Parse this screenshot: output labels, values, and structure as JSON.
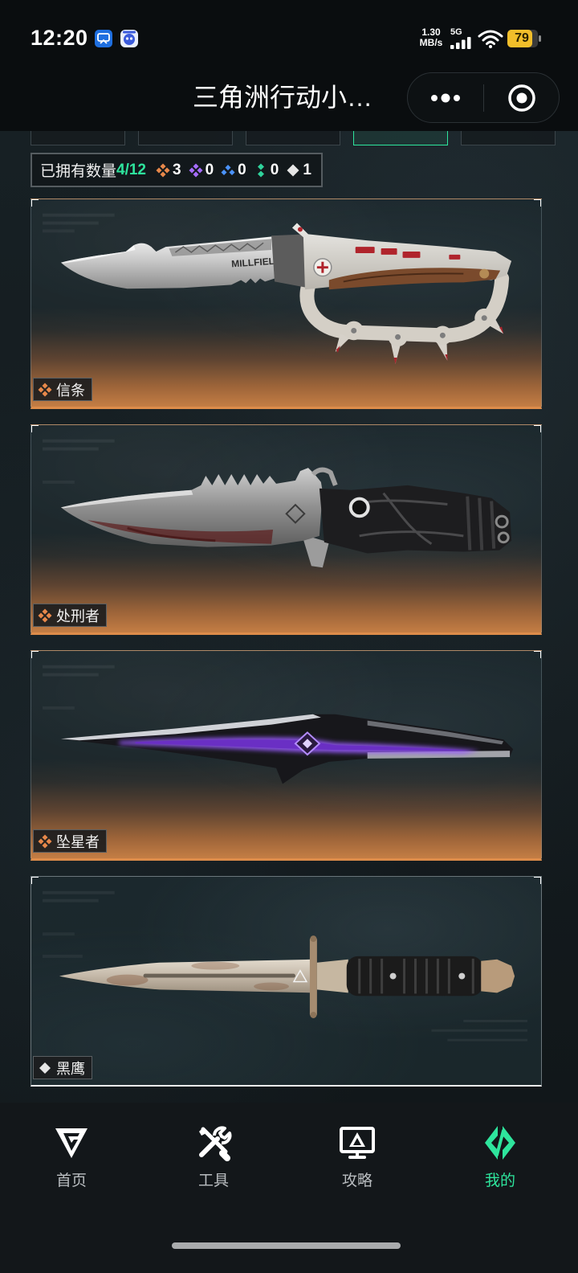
{
  "status_bar": {
    "time": "12:20",
    "notification_icons": [
      "app-notification-icon",
      "app-notification-icon"
    ],
    "net_speed": "1.30",
    "net_speed_unit": "MB/s",
    "network": "5G",
    "battery": "79"
  },
  "header": {
    "title": "三角洲行动小…",
    "more_icon": "more-dots-icon",
    "close_icon": "target-circle-icon"
  },
  "tabs": [
    {
      "active": false
    },
    {
      "active": false
    },
    {
      "active": false
    },
    {
      "active": true
    },
    {
      "active": false
    }
  ],
  "owned": {
    "label": "已拥有数量",
    "count": "4/12",
    "rarities": [
      {
        "icon": "orange-rarity-icon",
        "color": "#e8884a",
        "count": "3"
      },
      {
        "icon": "purple-rarity-icon",
        "color": "#a56cff",
        "count": "0"
      },
      {
        "icon": "blue-rarity-icon",
        "color": "#4b93ff",
        "count": "0"
      },
      {
        "icon": "green-rarity-icon",
        "color": "#2fd29b",
        "count": "0"
      },
      {
        "icon": "white-rarity-icon",
        "color": "#e6e6e6",
        "count": "1"
      }
    ]
  },
  "knives": [
    {
      "name": "信条",
      "rarity_icon": "orange-rarity-icon",
      "rarity_color": "#e8884a",
      "engraving": "MILLFIELD"
    },
    {
      "name": "处刑者",
      "rarity_icon": "orange-rarity-icon",
      "rarity_color": "#e8884a"
    },
    {
      "name": "坠星者",
      "rarity_icon": "orange-rarity-icon",
      "rarity_color": "#e8884a"
    },
    {
      "name": "黑鹰",
      "rarity_icon": "white-rarity-icon",
      "rarity_color": "#e6e6e6"
    }
  ],
  "bottom_nav": [
    {
      "label": "首页",
      "icon": "home-logo-icon",
      "active": false
    },
    {
      "label": "工具",
      "icon": "tools-icon",
      "active": false
    },
    {
      "label": "攻略",
      "icon": "guide-monitor-icon",
      "active": false
    },
    {
      "label": "我的",
      "icon": "profile-logo-icon",
      "active": true
    }
  ],
  "colors": {
    "accent": "#2ee59d",
    "orange": "#e8884a",
    "background": "#0f1417"
  }
}
